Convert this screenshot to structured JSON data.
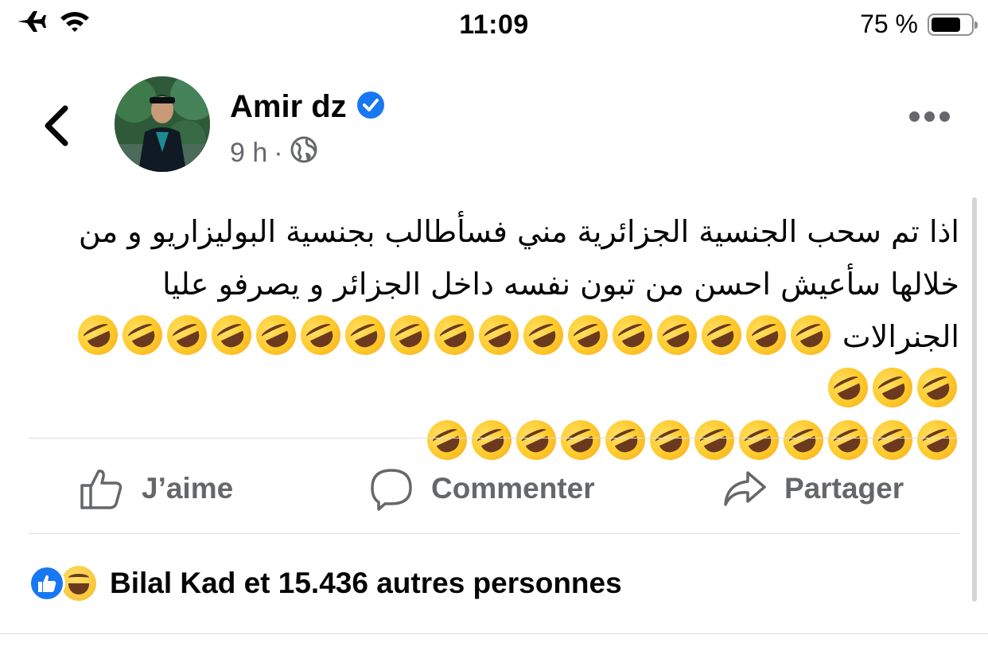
{
  "status_bar": {
    "time": "11:09",
    "battery_percent_text": "75 %",
    "battery_level": 0.75,
    "icons": [
      "airplane-icon",
      "wifi-icon",
      "battery-icon"
    ]
  },
  "post": {
    "author": "Amir dz",
    "verified": true,
    "time_ago": "9 h",
    "separator": "·",
    "audience_icon": "globe-icon",
    "text_line_1": "اذا تم سحب الجنسية الجزائرية مني فسأطالب بجنسية البوليزاريو و من",
    "text_line_2": "خلالها سأعيش احسن من تبون نفسه داخل الجزائر  و يصرفو عليا",
    "text_line_3": "الجنرالات",
    "emoji_name": "rolling-on-the-floor-laughing-emoji",
    "emoji_count_line_3": 20,
    "emoji_count_line_4": 12
  },
  "actions": {
    "like_label": "J’aime",
    "comment_label": "Commenter",
    "share_label": "Partager"
  },
  "reactions": {
    "types": [
      "like-reaction-icon",
      "haha-reaction-icon"
    ],
    "summary": "Bilal Kad et 15.436 autres personnes"
  },
  "colors": {
    "accent_blue": "#1877f2",
    "secondary_text": "#65676b",
    "divider": "#dadde1"
  }
}
